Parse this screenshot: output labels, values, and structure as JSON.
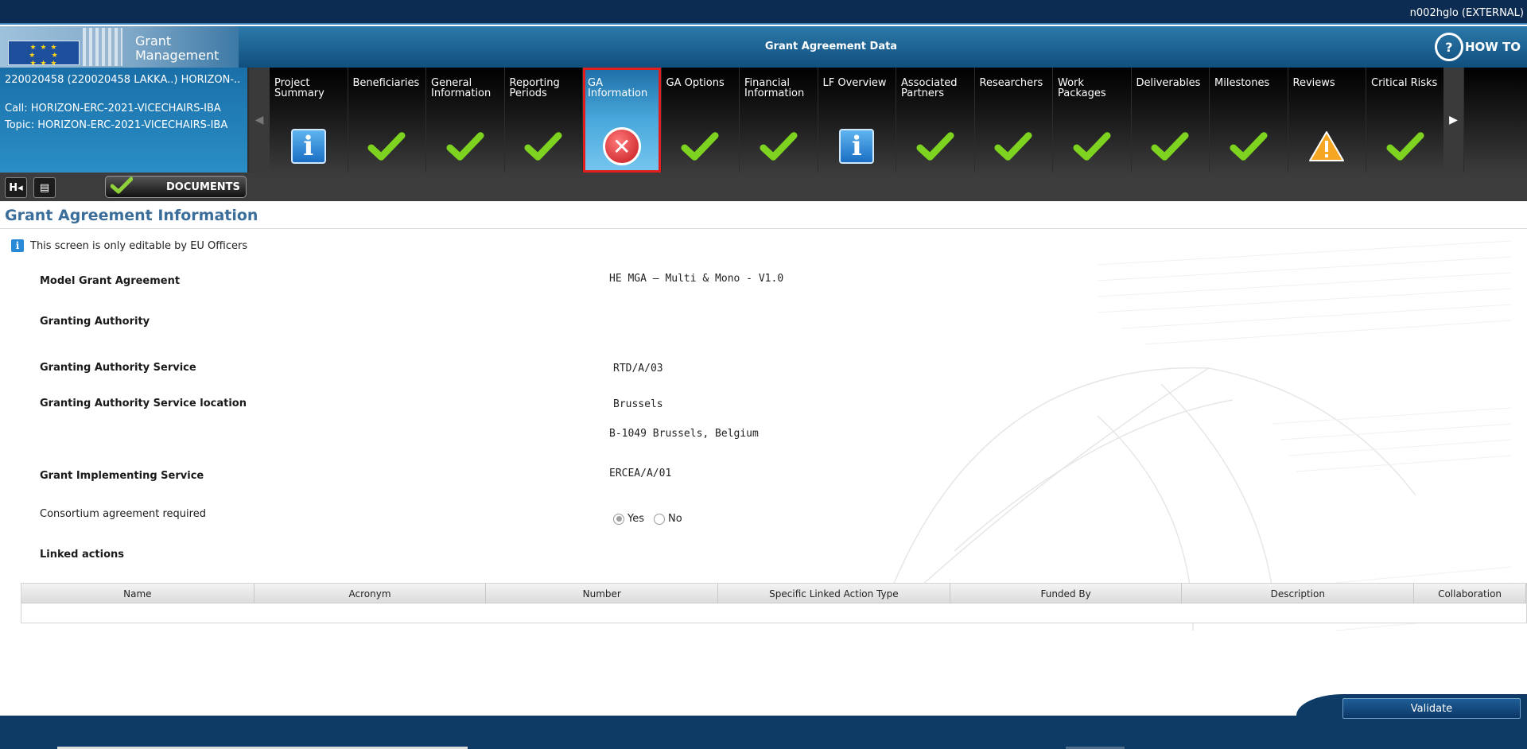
{
  "user": {
    "name": "n002hglo (EXTERNAL)"
  },
  "banner": {
    "app_title_line1": "Grant",
    "app_title_line2": "Management",
    "page_heading": "Grant Agreement Data",
    "howto_label": "HOW TO"
  },
  "project": {
    "id": "220020458 (220020458 LAKKA..) HORIZON-..",
    "call": "Call: HORIZON-ERC-2021-VICECHAIRS-IBA",
    "topic": "Topic: HORIZON-ERC-2021-VICECHAIRS-IBA"
  },
  "tabs": [
    {
      "label": "Project Summary",
      "status": "info",
      "status_icon": "info-icon"
    },
    {
      "label": "Beneficiaries",
      "status": "ok",
      "status_icon": "check-icon"
    },
    {
      "label": "General Information",
      "status": "ok",
      "status_icon": "check-icon"
    },
    {
      "label": "Reporting Periods",
      "status": "ok",
      "status_icon": "check-icon"
    },
    {
      "label": "GA Information",
      "status": "error",
      "status_icon": "error-icon",
      "active": true
    },
    {
      "label": "GA Options",
      "status": "ok",
      "status_icon": "check-icon"
    },
    {
      "label": "Financial Information",
      "status": "ok",
      "status_icon": "check-icon"
    },
    {
      "label": "LF Overview",
      "status": "info",
      "status_icon": "info-icon"
    },
    {
      "label": "Associated Partners",
      "status": "ok",
      "status_icon": "check-icon"
    },
    {
      "label": "Researchers",
      "status": "ok",
      "status_icon": "check-icon"
    },
    {
      "label": "Work Packages",
      "status": "ok",
      "status_icon": "check-icon"
    },
    {
      "label": "Deliverables",
      "status": "ok",
      "status_icon": "check-icon"
    },
    {
      "label": "Milestones",
      "status": "ok",
      "status_icon": "check-icon"
    },
    {
      "label": "Reviews",
      "status": "warning",
      "status_icon": "warning-icon"
    },
    {
      "label": "Critical Risks",
      "status": "ok",
      "status_icon": "check-icon"
    }
  ],
  "toolbar": {
    "documents_label": "DOCUMENTS"
  },
  "page": {
    "title": "Grant Agreement Information",
    "notice": "This screen is only editable by EU Officers"
  },
  "fields": {
    "model_grant_agreement": {
      "label": "Model Grant Agreement",
      "value": "HE MGA — Multi & Mono - V1.0"
    },
    "granting_authority": {
      "label": "Granting Authority",
      "value": ""
    },
    "granting_authority_service": {
      "label": "Granting Authority Service",
      "value": "RTD/A/03"
    },
    "granting_authority_service_location": {
      "label": "Granting Authority Service location",
      "value": "Brussels",
      "value2": "B-1049 Brussels, Belgium"
    },
    "grant_implementing_service": {
      "label": "Grant Implementing Service",
      "value": "ERCEA/A/01"
    },
    "consortium_agreement_required": {
      "label": "Consortium agreement required",
      "options": [
        "Yes",
        "No"
      ],
      "selected": "Yes"
    },
    "linked_actions": {
      "label": "Linked actions"
    }
  },
  "linked_actions_table": {
    "columns": [
      "Name",
      "Acronym",
      "Number",
      "Specific Linked Action Type",
      "Funded By",
      "Description",
      "Collaboration"
    ],
    "rows": []
  },
  "footer": {
    "validate_label": "Validate"
  },
  "colors": {
    "active_tab_outline": "#e11d1d",
    "title_blue": "#3b6e9a",
    "ok_green": "#7ed321",
    "warning_orange": "#f5a623"
  }
}
